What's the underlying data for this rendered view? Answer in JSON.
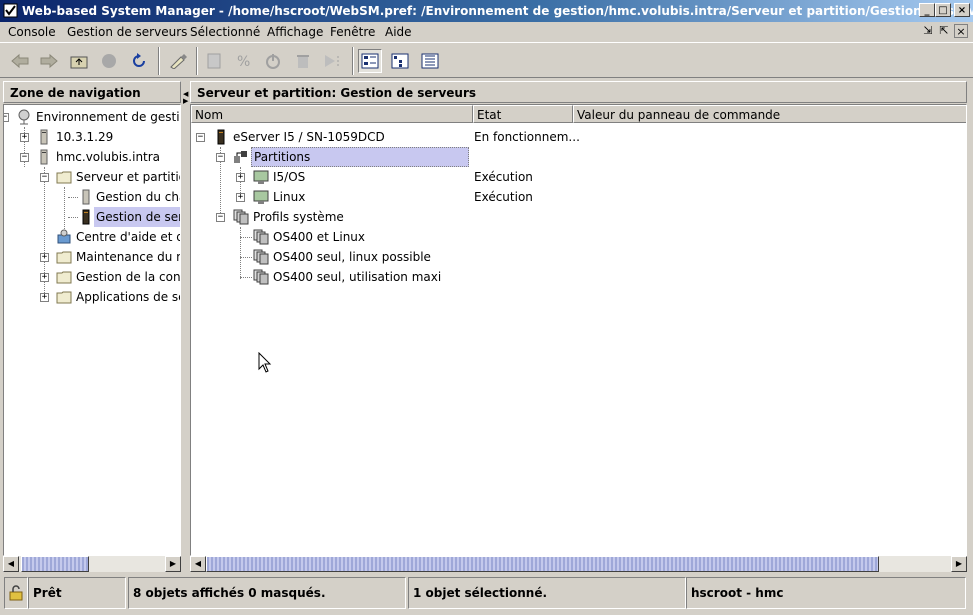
{
  "window": {
    "title": "Web-based System Manager - /home/hscroot/WebSM.pref: /Environnement de gestion/hmc.volubis.intra/Serveur et partition/Gestion de serveurs",
    "minimize": "_",
    "maximize": "□",
    "close": "×"
  },
  "menubar": {
    "items": [
      "Console",
      "Gestion de serveurs",
      "Sélectionné",
      "Affichage",
      "Fenêtre",
      "Aide"
    ]
  },
  "toolbar": {
    "buttons": [
      "back-icon",
      "forward-icon",
      "up-folder-icon",
      "stop-icon",
      "refresh-icon",
      "find-icon",
      "properties-icon",
      "percent-icon",
      "power-icon",
      "delete-icon",
      "run-icon",
      "large-icons-view-icon",
      "details-view-icon",
      "tree-view-icon"
    ]
  },
  "nav": {
    "header": "Zone de navigation",
    "items": [
      {
        "label": "Environnement de gestion",
        "icon": "globe-icon"
      },
      {
        "label": "10.3.1.29",
        "icon": "server-icon"
      },
      {
        "label": "hmc.volubis.intra",
        "icon": "server-icon"
      },
      {
        "label": "Serveur et partition",
        "icon": "folder-icon"
      },
      {
        "label": "Gestion du châssis",
        "icon": "chassis-icon"
      },
      {
        "label": "Gestion de serveurs",
        "icon": "server-dark-icon"
      },
      {
        "label": "Centre d'aide et d'informations",
        "icon": "help-center-icon"
      },
      {
        "label": "Maintenance du microcode",
        "icon": "folder-icon"
      },
      {
        "label": "Gestion de la console",
        "icon": "folder-icon"
      },
      {
        "label": "Applications de service",
        "icon": "folder-icon"
      }
    ]
  },
  "main": {
    "header": "Serveur et partition: Gestion de serveurs",
    "columns": [
      "Nom",
      "Etat",
      "Valeur du panneau de commande"
    ],
    "rows": [
      {
        "name": "eServer I5 / SN-1059DCD",
        "state": "En fonctionnem...",
        "value": ""
      },
      {
        "name": "Partitions",
        "state": "",
        "value": ""
      },
      {
        "name": "I5/OS",
        "state": "Exécution",
        "value": ""
      },
      {
        "name": "Linux",
        "state": "Exécution",
        "value": ""
      },
      {
        "name": "Profils système",
        "state": "",
        "value": ""
      },
      {
        "name": "OS400 et Linux",
        "state": "",
        "value": ""
      },
      {
        "name": "OS400 seul, linux possible",
        "state": "",
        "value": ""
      },
      {
        "name": "OS400 seul, utilisation maxi",
        "state": "",
        "value": ""
      }
    ]
  },
  "status": {
    "ready": "Prêt",
    "objects": "8 objets affichés 0 masqués.",
    "selection": "1 objet sélectionné.",
    "user": "hscroot - hmc"
  },
  "colors": {
    "title_start": "#0a246a",
    "selection": "#c8c8f0",
    "thumb": "#9fa8d8"
  }
}
